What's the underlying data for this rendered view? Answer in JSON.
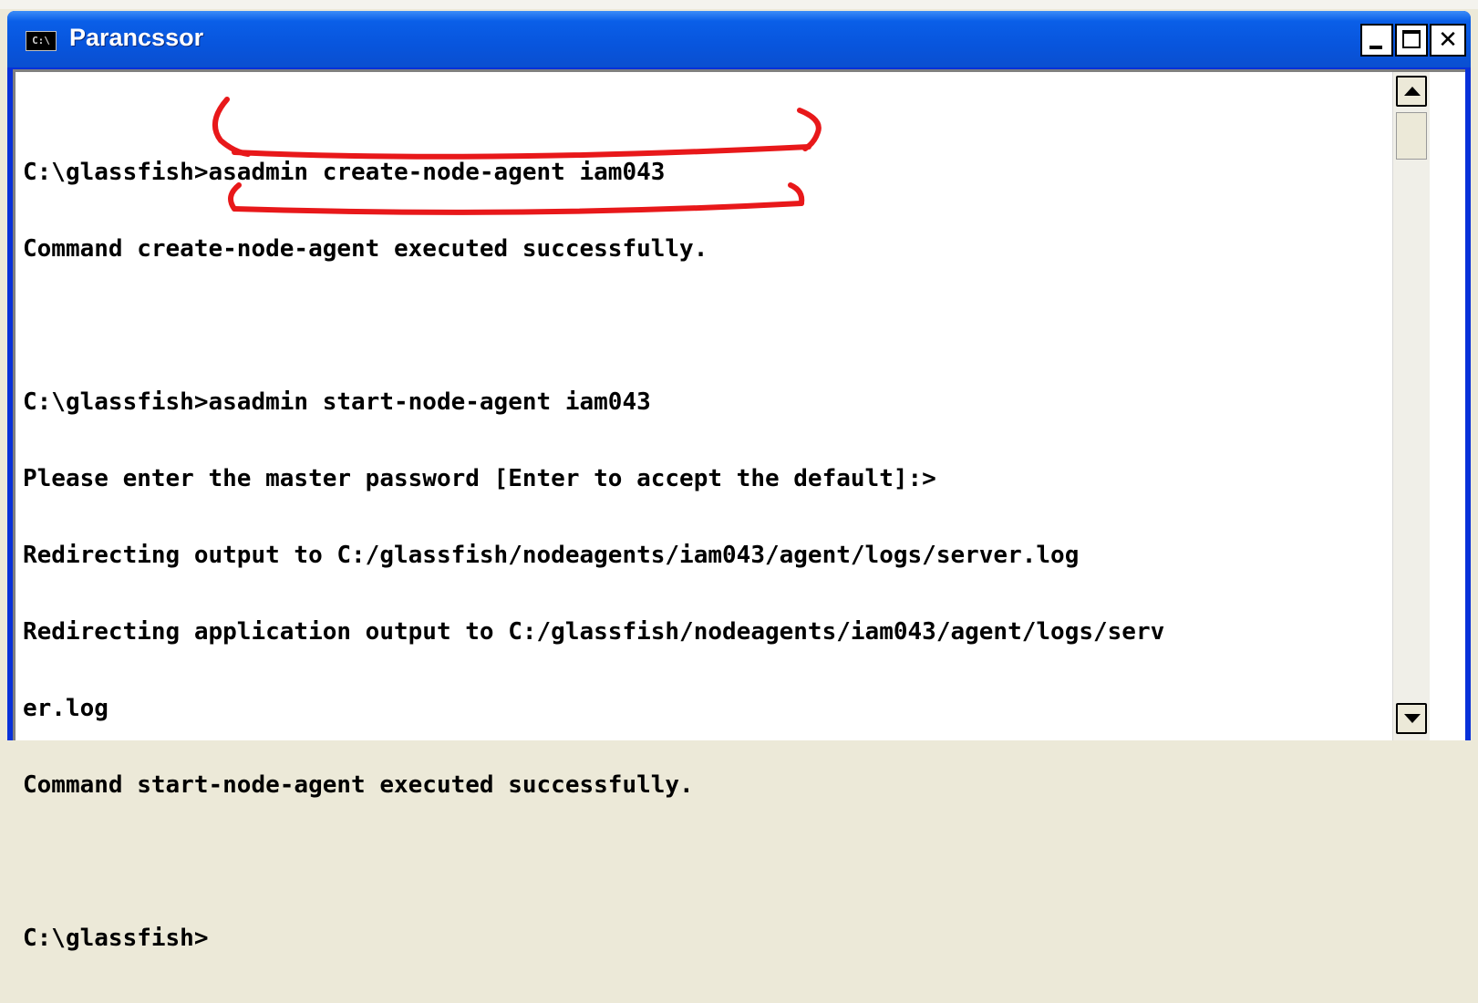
{
  "window": {
    "title": "Parancssor",
    "icon": "console-icon",
    "icon_label": "C:\\"
  },
  "console": {
    "lines": [
      "C:\\glassfish>asadmin create-node-agent iam043",
      "Command create-node-agent executed successfully.",
      "",
      "C:\\glassfish>asadmin start-node-agent iam043",
      "Please enter the master password [Enter to accept the default]:>",
      "Redirecting output to C:/glassfish/nodeagents/iam043/agent/logs/server.log",
      "Redirecting application output to C:/glassfish/nodeagents/iam043/agent/logs/serv",
      "er.log",
      "Command start-node-agent executed successfully.",
      "",
      "C:\\glassfish>"
    ]
  },
  "colors": {
    "titlebar": "#0a5fe8",
    "annotation": "#e8181a",
    "console_bg": "#ffffff",
    "console_text": "#000000"
  }
}
